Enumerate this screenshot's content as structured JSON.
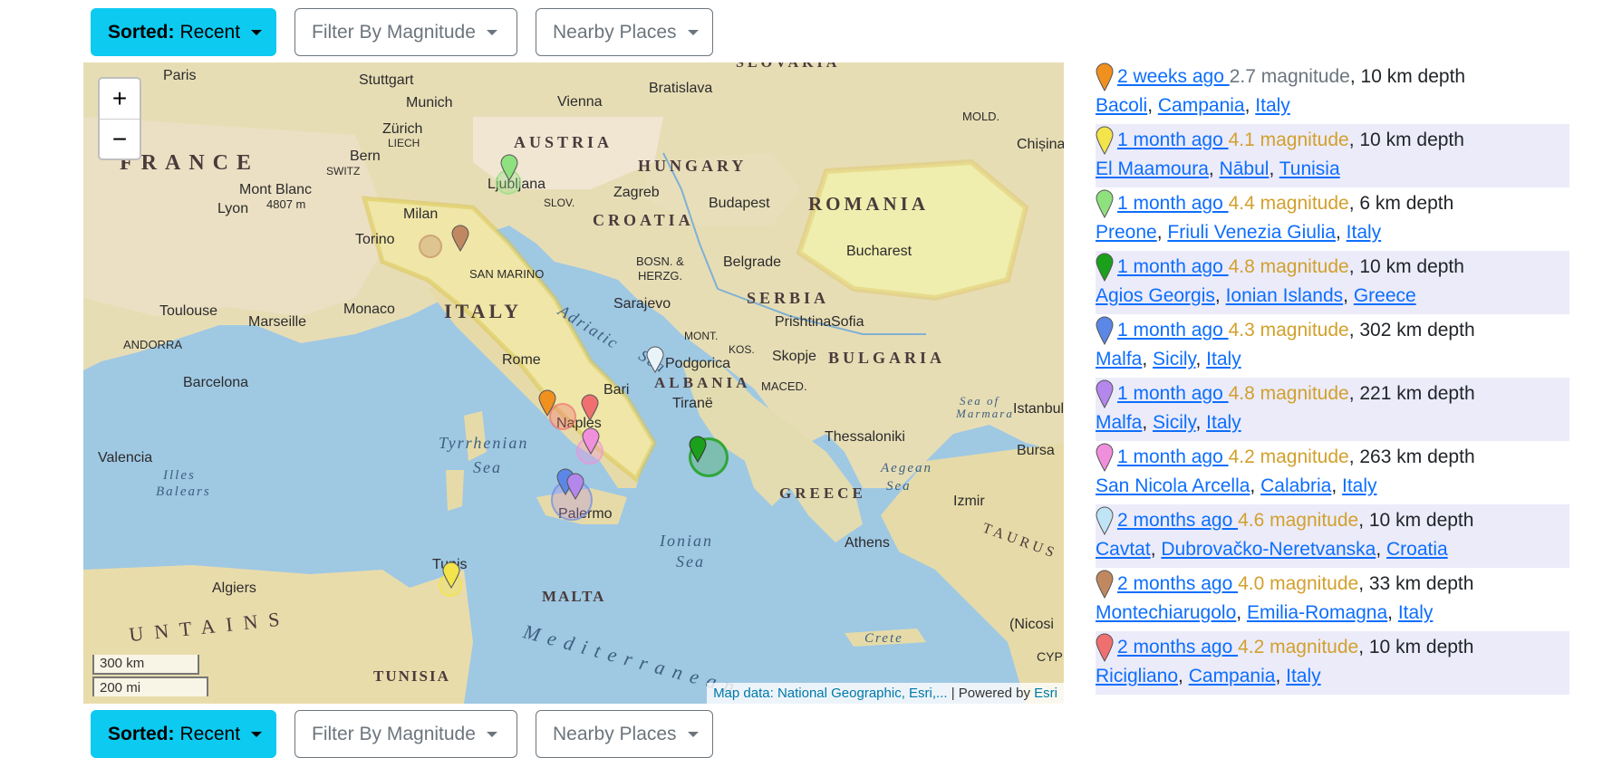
{
  "toolbar": {
    "sort_prefix": "Sorted:",
    "sort_value": "Recent",
    "magnitude_label": "Filter By Magnitude",
    "nearby_label": "Nearby Places"
  },
  "map": {
    "zoom_in": "+",
    "zoom_out": "−",
    "scale_metric": "300 km",
    "scale_imperial": "200 mi",
    "attribution_text": "Map data: National Geographic, Esri,...",
    "attribution_sep": " | Powered by ",
    "attribution_link": "Esri",
    "labels": {
      "paris": "Paris",
      "stuttgart": "Stuttgart",
      "munich": "Munich",
      "vienna": "Vienna",
      "bratislava": "Bratislava",
      "budapest": "Budapest",
      "zurich": "Zürich",
      "liech": "LIECH",
      "bern": "Bern",
      "switz": "SWITZ",
      "austria": "AUSTRIA",
      "hungary": "HUNGARY",
      "france": "FRANCE",
      "romania": "ROMANIA",
      "mold": "MOLD.",
      "chisina": "Chișina",
      "mont_blanc": "Mont Blanc",
      "mont_blanc_h": "4807 m",
      "lyon": "Lyon",
      "ljubljana": "Ljubljana",
      "slov": "SLOV.",
      "zagreb": "Zagreb",
      "croatia": "CROATIA",
      "milan": "Milan",
      "torino": "Torino",
      "bosn": "BOSN. &",
      "herzg": "HERZG.",
      "belgrade": "Belgrade",
      "bucharest": "Bucharest",
      "san_marino": "SAN MARINO",
      "serbia": "SERBIA",
      "toulouse": "Toulouse",
      "monaco": "Monaco",
      "marseille": "Marseille",
      "italy": "ITALY",
      "sarajevo": "Sarajevo",
      "andorra": "ANDORRA",
      "adriatic": "Adriatic",
      "prishtina": "Prishtina",
      "sofia": "Sofia",
      "mont": "MONT.",
      "kos": "KOS.",
      "skopje": "Skopje",
      "bulgaria": "BULGARIA",
      "rome": "Rome",
      "podgorica": "Podgorica",
      "albania": "ALBANIA",
      "maced": "MACED.",
      "barcelona": "Barcelona",
      "bari": "Bari",
      "tirane": "Tiranë",
      "naples": "Naples",
      "thessaloniki": "Thessaloniki",
      "istanbul": "Istanbul",
      "sea_of": "Sea of",
      "marmara": "Marmara",
      "bursa": "Bursa",
      "valencia": "Valencia",
      "tyrrhenian": "Tyrrhenian",
      "sea": "Sea",
      "illes": "Illes",
      "balears": "Balears",
      "aegean": "Aegean",
      "palermo": "Palermo",
      "greece": "GREECE",
      "izmir": "Izmir",
      "ionian": "Ionian",
      "athens": "Athens",
      "taurus": "TAURUS",
      "tunis": "Tunis",
      "algiers": "Algiers",
      "malta": "MALTA",
      "mediterranean": "Mediterranean",
      "nicosia": "(Nicosi",
      "crete": "Crete",
      "cyp": "CYP",
      "untains": "UNTAINS",
      "tunisia": "TUNISIA",
      "slovakia": "SLOVAKIA",
      "sea2": "Sea"
    }
  },
  "earthquakes": [
    {
      "time": "2 weeks ago ",
      "magnitude": "2.7 magnitude",
      "depth": ", 10 km depth",
      "place": [
        "Bacoli",
        "Campania",
        "Italy"
      ],
      "color": "#f0901e",
      "mag_color": "grey"
    },
    {
      "time": "1 month ago ",
      "magnitude": "4.1 magnitude",
      "depth": ", 10 km depth",
      "place": [
        "El Maamoura",
        "Nābul",
        "Tunisia"
      ],
      "color": "#f2e44a",
      "mag_color": "gold"
    },
    {
      "time": "1 month ago ",
      "magnitude": "4.4 magnitude",
      "depth": ", 6 km depth",
      "place": [
        "Preone",
        "Friuli Venezia Giulia",
        "Italy"
      ],
      "color": "#8fe07e",
      "mag_color": "gold"
    },
    {
      "time": "1 month ago ",
      "magnitude": "4.8 magnitude",
      "depth": ", 10 km depth",
      "place": [
        "Agios Georgis",
        "Ionian Islands",
        "Greece"
      ],
      "color": "#1aa01a",
      "mag_color": "gold"
    },
    {
      "time": "1 month ago ",
      "magnitude": "4.3 magnitude",
      "depth": ", 302 km depth",
      "place": [
        "Malfa",
        "Sicily",
        "Italy"
      ],
      "color": "#5b87e6",
      "mag_color": "gold"
    },
    {
      "time": "1 month ago ",
      "magnitude": "4.8 magnitude",
      "depth": ", 221 km depth",
      "place": [
        "Malfa",
        "Sicily",
        "Italy"
      ],
      "color": "#b487ec",
      "mag_color": "gold"
    },
    {
      "time": "1 month ago ",
      "magnitude": "4.2 magnitude",
      "depth": ", 263 km depth",
      "place": [
        "San Nicola Arcella",
        "Calabria",
        "Italy"
      ],
      "color": "#f08fdc",
      "mag_color": "gold"
    },
    {
      "time": "2 months ago ",
      "magnitude": "4.6 magnitude",
      "depth": ", 10 km depth",
      "place": [
        "Cavtat",
        "Dubrovačko-Neretvanska",
        "Croatia"
      ],
      "color": "#bfe4f5",
      "mag_color": "gold"
    },
    {
      "time": "2 months ago ",
      "magnitude": "4.0 magnitude",
      "depth": ", 33 km depth",
      "place": [
        "Montechiarugolo",
        "Emilia-Romagna",
        "Italy"
      ],
      "color": "#c08860",
      "mag_color": "gold"
    },
    {
      "time": "2 months ago ",
      "magnitude": "4.2 magnitude",
      "depth": ", 10 km depth",
      "place": [
        "Ricigliano",
        "Campania",
        "Italy"
      ],
      "color": "#f07070",
      "mag_color": "gold"
    }
  ]
}
